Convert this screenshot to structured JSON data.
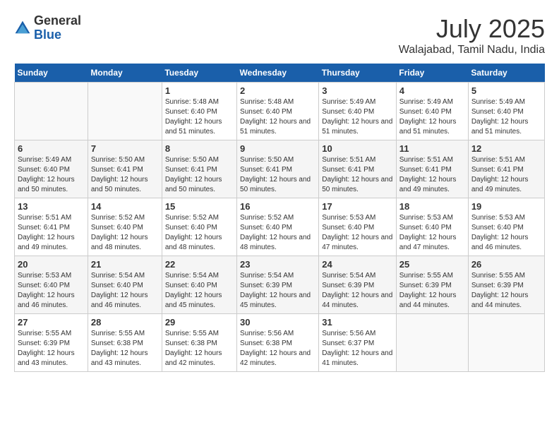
{
  "header": {
    "logo_general": "General",
    "logo_blue": "Blue",
    "month_year": "July 2025",
    "location": "Walajabad, Tamil Nadu, India"
  },
  "days_of_week": [
    "Sunday",
    "Monday",
    "Tuesday",
    "Wednesday",
    "Thursday",
    "Friday",
    "Saturday"
  ],
  "weeks": [
    [
      {
        "day": "",
        "sunrise": "",
        "sunset": "",
        "daylight": ""
      },
      {
        "day": "",
        "sunrise": "",
        "sunset": "",
        "daylight": ""
      },
      {
        "day": "1",
        "sunrise": "Sunrise: 5:48 AM",
        "sunset": "Sunset: 6:40 PM",
        "daylight": "Daylight: 12 hours and 51 minutes."
      },
      {
        "day": "2",
        "sunrise": "Sunrise: 5:48 AM",
        "sunset": "Sunset: 6:40 PM",
        "daylight": "Daylight: 12 hours and 51 minutes."
      },
      {
        "day": "3",
        "sunrise": "Sunrise: 5:49 AM",
        "sunset": "Sunset: 6:40 PM",
        "daylight": "Daylight: 12 hours and 51 minutes."
      },
      {
        "day": "4",
        "sunrise": "Sunrise: 5:49 AM",
        "sunset": "Sunset: 6:40 PM",
        "daylight": "Daylight: 12 hours and 51 minutes."
      },
      {
        "day": "5",
        "sunrise": "Sunrise: 5:49 AM",
        "sunset": "Sunset: 6:40 PM",
        "daylight": "Daylight: 12 hours and 51 minutes."
      }
    ],
    [
      {
        "day": "6",
        "sunrise": "Sunrise: 5:49 AM",
        "sunset": "Sunset: 6:40 PM",
        "daylight": "Daylight: 12 hours and 50 minutes."
      },
      {
        "day": "7",
        "sunrise": "Sunrise: 5:50 AM",
        "sunset": "Sunset: 6:41 PM",
        "daylight": "Daylight: 12 hours and 50 minutes."
      },
      {
        "day": "8",
        "sunrise": "Sunrise: 5:50 AM",
        "sunset": "Sunset: 6:41 PM",
        "daylight": "Daylight: 12 hours and 50 minutes."
      },
      {
        "day": "9",
        "sunrise": "Sunrise: 5:50 AM",
        "sunset": "Sunset: 6:41 PM",
        "daylight": "Daylight: 12 hours and 50 minutes."
      },
      {
        "day": "10",
        "sunrise": "Sunrise: 5:51 AM",
        "sunset": "Sunset: 6:41 PM",
        "daylight": "Daylight: 12 hours and 50 minutes."
      },
      {
        "day": "11",
        "sunrise": "Sunrise: 5:51 AM",
        "sunset": "Sunset: 6:41 PM",
        "daylight": "Daylight: 12 hours and 49 minutes."
      },
      {
        "day": "12",
        "sunrise": "Sunrise: 5:51 AM",
        "sunset": "Sunset: 6:41 PM",
        "daylight": "Daylight: 12 hours and 49 minutes."
      }
    ],
    [
      {
        "day": "13",
        "sunrise": "Sunrise: 5:51 AM",
        "sunset": "Sunset: 6:41 PM",
        "daylight": "Daylight: 12 hours and 49 minutes."
      },
      {
        "day": "14",
        "sunrise": "Sunrise: 5:52 AM",
        "sunset": "Sunset: 6:40 PM",
        "daylight": "Daylight: 12 hours and 48 minutes."
      },
      {
        "day": "15",
        "sunrise": "Sunrise: 5:52 AM",
        "sunset": "Sunset: 6:40 PM",
        "daylight": "Daylight: 12 hours and 48 minutes."
      },
      {
        "day": "16",
        "sunrise": "Sunrise: 5:52 AM",
        "sunset": "Sunset: 6:40 PM",
        "daylight": "Daylight: 12 hours and 48 minutes."
      },
      {
        "day": "17",
        "sunrise": "Sunrise: 5:53 AM",
        "sunset": "Sunset: 6:40 PM",
        "daylight": "Daylight: 12 hours and 47 minutes."
      },
      {
        "day": "18",
        "sunrise": "Sunrise: 5:53 AM",
        "sunset": "Sunset: 6:40 PM",
        "daylight": "Daylight: 12 hours and 47 minutes."
      },
      {
        "day": "19",
        "sunrise": "Sunrise: 5:53 AM",
        "sunset": "Sunset: 6:40 PM",
        "daylight": "Daylight: 12 hours and 46 minutes."
      }
    ],
    [
      {
        "day": "20",
        "sunrise": "Sunrise: 5:53 AM",
        "sunset": "Sunset: 6:40 PM",
        "daylight": "Daylight: 12 hours and 46 minutes."
      },
      {
        "day": "21",
        "sunrise": "Sunrise: 5:54 AM",
        "sunset": "Sunset: 6:40 PM",
        "daylight": "Daylight: 12 hours and 46 minutes."
      },
      {
        "day": "22",
        "sunrise": "Sunrise: 5:54 AM",
        "sunset": "Sunset: 6:40 PM",
        "daylight": "Daylight: 12 hours and 45 minutes."
      },
      {
        "day": "23",
        "sunrise": "Sunrise: 5:54 AM",
        "sunset": "Sunset: 6:39 PM",
        "daylight": "Daylight: 12 hours and 45 minutes."
      },
      {
        "day": "24",
        "sunrise": "Sunrise: 5:54 AM",
        "sunset": "Sunset: 6:39 PM",
        "daylight": "Daylight: 12 hours and 44 minutes."
      },
      {
        "day": "25",
        "sunrise": "Sunrise: 5:55 AM",
        "sunset": "Sunset: 6:39 PM",
        "daylight": "Daylight: 12 hours and 44 minutes."
      },
      {
        "day": "26",
        "sunrise": "Sunrise: 5:55 AM",
        "sunset": "Sunset: 6:39 PM",
        "daylight": "Daylight: 12 hours and 44 minutes."
      }
    ],
    [
      {
        "day": "27",
        "sunrise": "Sunrise: 5:55 AM",
        "sunset": "Sunset: 6:39 PM",
        "daylight": "Daylight: 12 hours and 43 minutes."
      },
      {
        "day": "28",
        "sunrise": "Sunrise: 5:55 AM",
        "sunset": "Sunset: 6:38 PM",
        "daylight": "Daylight: 12 hours and 43 minutes."
      },
      {
        "day": "29",
        "sunrise": "Sunrise: 5:55 AM",
        "sunset": "Sunset: 6:38 PM",
        "daylight": "Daylight: 12 hours and 42 minutes."
      },
      {
        "day": "30",
        "sunrise": "Sunrise: 5:56 AM",
        "sunset": "Sunset: 6:38 PM",
        "daylight": "Daylight: 12 hours and 42 minutes."
      },
      {
        "day": "31",
        "sunrise": "Sunrise: 5:56 AM",
        "sunset": "Sunset: 6:37 PM",
        "daylight": "Daylight: 12 hours and 41 minutes."
      },
      {
        "day": "",
        "sunrise": "",
        "sunset": "",
        "daylight": ""
      },
      {
        "day": "",
        "sunrise": "",
        "sunset": "",
        "daylight": ""
      }
    ]
  ]
}
